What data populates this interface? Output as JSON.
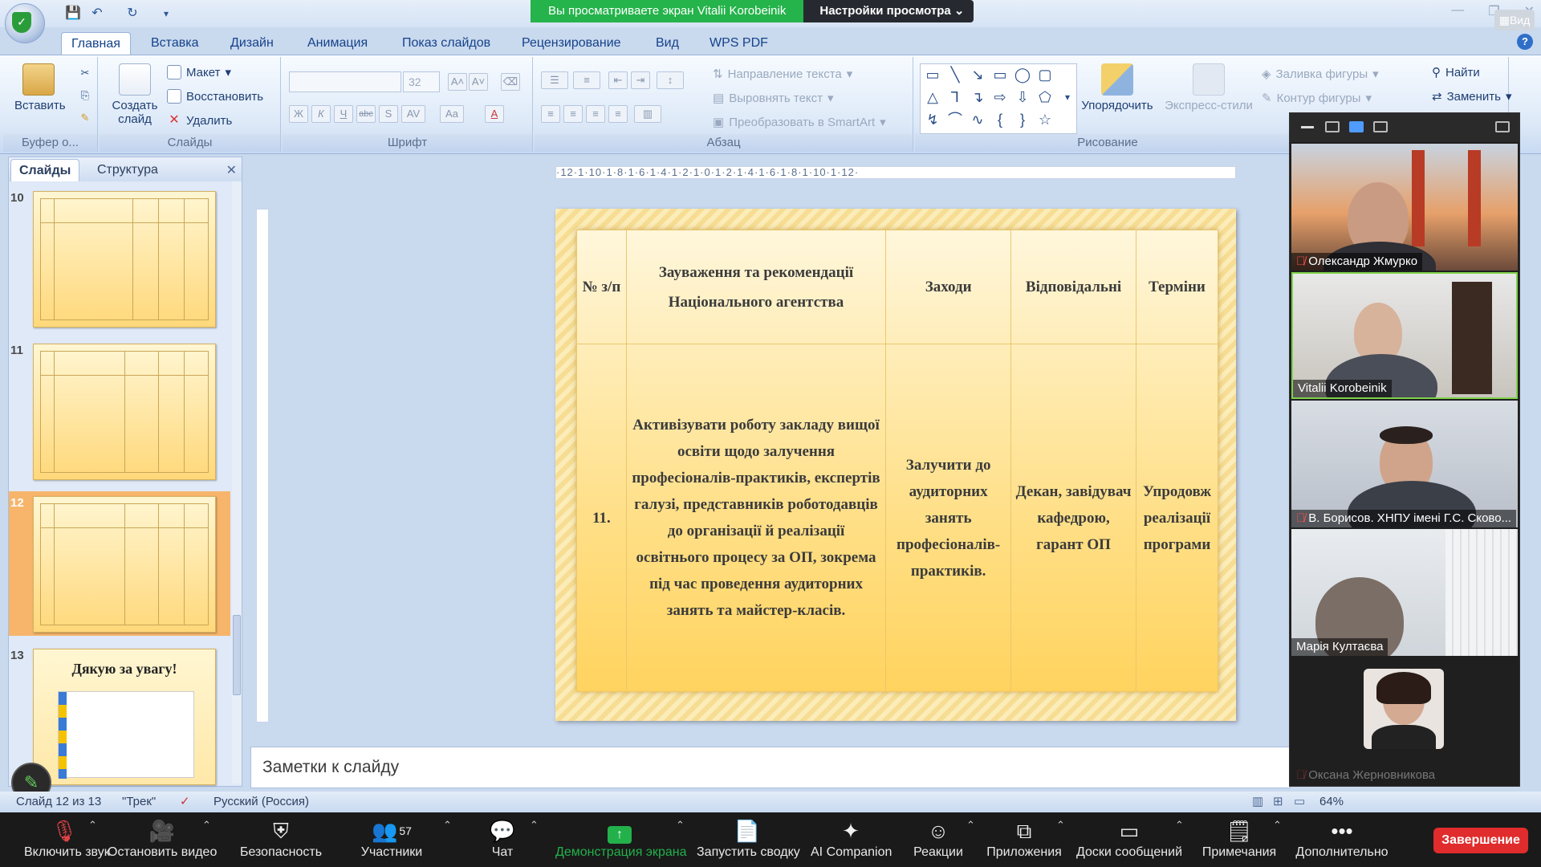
{
  "zoom_banner": {
    "viewing_text": "Вы просматриваете экран Vitalii Korobeinik",
    "view_options_label": "Настройки просмотра",
    "view_btn": "Вид"
  },
  "ribbon": {
    "tabs": [
      "Главная",
      "Вставка",
      "Дизайн",
      "Анимация",
      "Показ слайдов",
      "Рецензирование",
      "Вид",
      "WPS PDF"
    ],
    "active_tab": "Главная",
    "clipboard": {
      "paste": "Вставить",
      "label": "Буфер о..."
    },
    "slides": {
      "create": "Создать слайд",
      "layout": "Макет",
      "reset": "Восстановить",
      "delete": "Удалить",
      "label": "Слайды"
    },
    "font": {
      "size": "32",
      "label": "Шрифт",
      "bold": "Ж",
      "italic": "К",
      "underline": "Ч",
      "strike": "abc",
      "shadow": "S",
      "spacing": "AV",
      "case": "Aa"
    },
    "paragraph": {
      "text_direction": "Направление текста",
      "align_text": "Выровнять текст",
      "convert_smartart": "Преобразовать в SmartArt",
      "label": "Абзац"
    },
    "drawing": {
      "arrange": "Упорядочить",
      "quick_styles": "Экспресс-стили",
      "shape_fill": "Заливка фигуры",
      "shape_outline": "Контур фигуры",
      "label": "Рисование"
    },
    "editing": {
      "find": "Найти",
      "replace": "Заменить"
    }
  },
  "left_panel": {
    "tabs": [
      "Слайды",
      "Структура"
    ],
    "active_tab": "Слайды",
    "thumbnails": [
      {
        "num": "10",
        "selected": false
      },
      {
        "num": "11",
        "selected": false
      },
      {
        "num": "12",
        "selected": true
      },
      {
        "num": "13",
        "selected": false,
        "title": "Дякую за увагу!"
      }
    ]
  },
  "ruler": {
    "h_text": "·12·1·10·1·8·1·6·1·4·1·2·1·0·1·2·1·4·1·6·1·8·1·10·1·12·"
  },
  "slide": {
    "headers": [
      "№ з/п",
      "Зауваження та рекомендації Національного агентства",
      "Заходи",
      "Відповідальні",
      "Терміни"
    ],
    "row": {
      "num": "11.",
      "remark": "Активізувати роботу закладу вищої освіти щодо залучення професіоналів-практиків, експертів галузі, представників роботодавців до організації й реалізації освітнього процесу за ОП, зокрема під час проведення аудиторних занять та майстер-класів.",
      "measures": "Залучити до аудиторних занять професіоналів-практиків.",
      "responsible": "Декан, завідувач кафедрою, гарант ОП",
      "terms": "Упродовж реалізації програми"
    }
  },
  "notes": {
    "placeholder": "Заметки к слайду"
  },
  "status": {
    "slide_pos": "Слайд 12 из 13",
    "theme": "\"Трек\"",
    "language": "Русский (Россия)",
    "zoom": "64%"
  },
  "participants": [
    {
      "name": "Олександр Жмурко",
      "muted": true
    },
    {
      "name": "Vitalii Korobeinik",
      "muted": false,
      "active": true
    },
    {
      "name": "В. Борисов. ХНПУ імені Г.С. Сково...",
      "muted": true
    },
    {
      "name": "Марія  Култаєва",
      "muted": false
    },
    {
      "name": "Оксана Жерновникова",
      "muted": true
    }
  ],
  "zoom_toolbar": {
    "audio": "Включить звук",
    "video": "Остановить видео",
    "security": "Безопасность",
    "participants": "Участники",
    "participants_count": "57",
    "chat": "Чат",
    "share": "Демонстрация экрана",
    "summary": "Запустить сводку",
    "companion": "AI Companion",
    "reactions": "Реакции",
    "apps": "Приложения",
    "whiteboards": "Доски сообщений",
    "notes": "Примечания",
    "more": "Дополнительно",
    "end": "Завершение"
  }
}
